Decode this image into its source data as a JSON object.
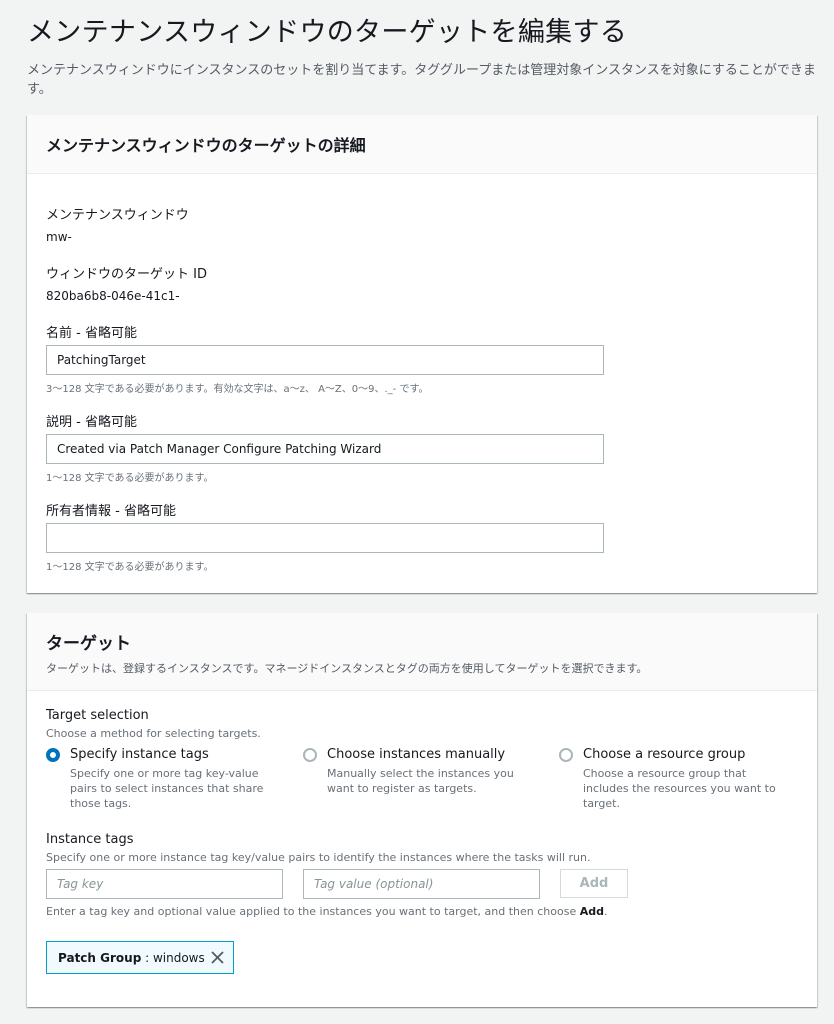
{
  "page": {
    "title": "メンテナンスウィンドウのターゲットを編集する",
    "description": "メンテナンスウィンドウにインスタンスのセットを割り当てます。タググループまたは管理対象インスタンスを対象にすることができます。"
  },
  "details": {
    "title": "メンテナンスウィンドウのターゲットの詳細",
    "window_label": "メンテナンスウィンドウ",
    "window_value": "mw-",
    "target_id_label": "ウィンドウのターゲット ID",
    "target_id_value": "820ba6b8-046e-41c1-",
    "name_label": "名前 - 省略可能",
    "name_value": "PatchingTarget",
    "name_hint": "3〜128 文字である必要があります。有効な文字は、a〜z、 A〜Z、0〜9、._- です。",
    "desc_label": "説明 - 省略可能",
    "desc_value": "Created via Patch Manager Configure Patching Wizard",
    "desc_hint": "1〜128 文字である必要があります。",
    "owner_label": "所有者情報 - 省略可能",
    "owner_value": "",
    "owner_hint": "1〜128 文字である必要があります。"
  },
  "targets": {
    "title": "ターゲット",
    "subtitle": "ターゲットは、登録するインスタンスです。マネージドインスタンスとタグの両方を使用してターゲットを選択できます。",
    "selection_label": "Target selection",
    "selection_hint": "Choose a method for selecting targets.",
    "options": [
      {
        "title": "Specify instance tags",
        "desc": "Specify one or more tag key-value pairs to select instances that share those tags.",
        "selected": true
      },
      {
        "title": "Choose instances manually",
        "desc": "Manually select the instances you want to register as targets.",
        "selected": false
      },
      {
        "title": "Choose a resource group",
        "desc": "Choose a resource group that includes the resources you want to target.",
        "selected": false
      }
    ],
    "tags_label": "Instance tags",
    "tags_hint": "Specify one or more instance tag key/value pairs to identify the instances where the tasks will run.",
    "tag_key_placeholder": "Tag key",
    "tag_value_placeholder": "Tag value (optional)",
    "add_label": "Add",
    "help_prefix": "Enter a tag key and optional value applied to the instances you want to target, and then choose ",
    "help_strong": "Add",
    "help_suffix": ".",
    "token_key": "Patch Group",
    "token_sep": " : ",
    "token_value": "windows"
  },
  "colors": {
    "accent": "#0073bb",
    "token_border": "#00a1c9",
    "background": "#f2f3f3"
  },
  "icons": [
    "close-icon"
  ]
}
